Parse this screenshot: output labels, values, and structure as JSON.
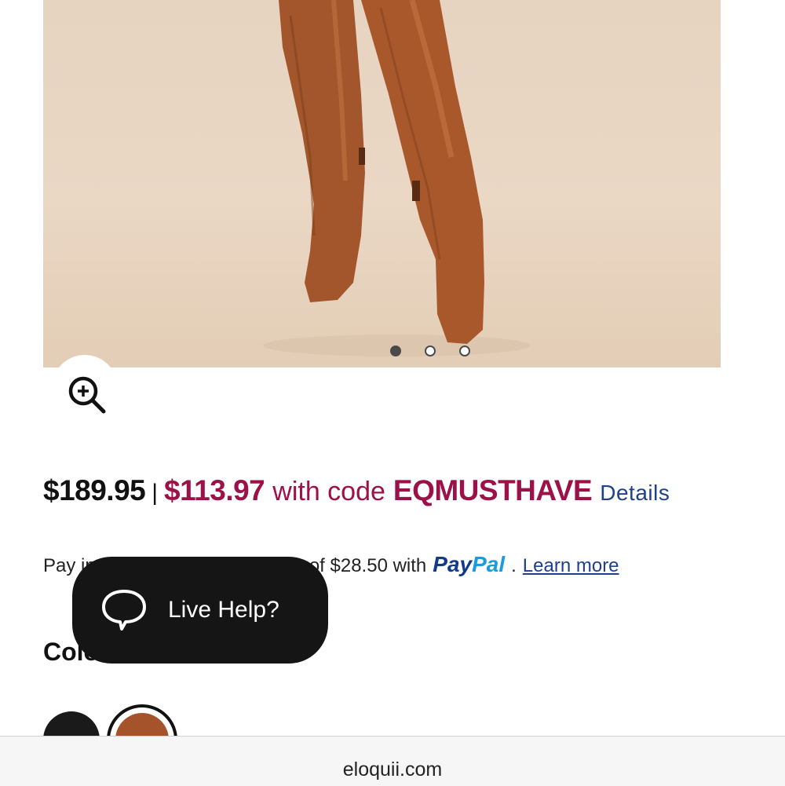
{
  "product": {
    "image_alt": "Cognac knee-high boots",
    "gallery_dots": [
      true,
      false,
      false
    ]
  },
  "pricing": {
    "original": "$189.95",
    "separator": "|",
    "sale": "$113.97",
    "with_text": "with code",
    "code": "EQMUSTHAVE",
    "details_link": "Details"
  },
  "paypal": {
    "prefix": "Pay in 4 interest-free payments of $28.50 with",
    "logo_part1": "Pay",
    "logo_part2": "Pal",
    "dot": ".",
    "learn_more": "Learn more"
  },
  "color": {
    "label": "Color",
    "swatches": [
      {
        "name": "black",
        "hex": "#1a1a1a"
      },
      {
        "name": "cognac",
        "hex": "#a5532a"
      }
    ]
  },
  "chat": {
    "label": "Live Help?"
  },
  "browser": {
    "domain": "eloquii.com"
  },
  "colors": {
    "sale_accent": "#9c1148",
    "link_blue": "#1f3f8f",
    "paypal_navy": "#123a8c",
    "paypal_light": "#1a9be0"
  }
}
